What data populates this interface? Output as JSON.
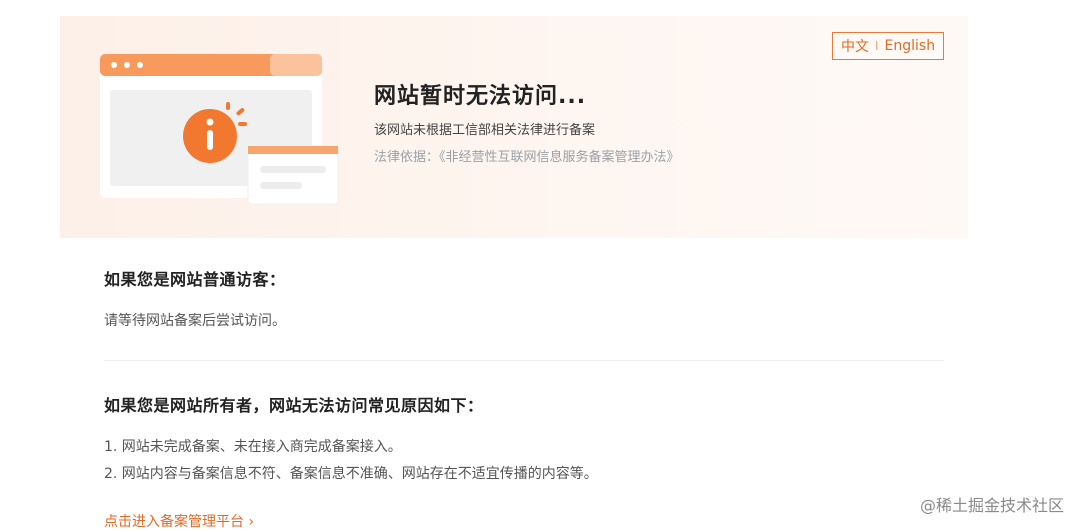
{
  "banner": {
    "title": "网站暂时无法访问...",
    "description": "该网站未根据工信部相关法律进行备案",
    "law_reference": "法律依据：《非经营性互联网信息服务备案管理办法》",
    "language_switch": {
      "chinese": "中文",
      "separator": "I",
      "english": "English"
    }
  },
  "visitor": {
    "heading": "如果您是网站普通访客：",
    "text": "请等待网站备案后尝试访问。"
  },
  "owner": {
    "heading": "如果您是网站所有者，网站无法访问常见原因如下：",
    "reasons": [
      "1. 网站未完成备案、未在接入商完成备案接入。",
      "2. 网站内容与备案信息不符、备案信息不准确、网站存在不适宜传播的内容等。"
    ]
  },
  "platform_link": "点击进入备案管理平台 ›",
  "watermark": "@稀土掘金技术社区",
  "colors": {
    "accent": "#e06a26",
    "banner_bg": "#fdf0e8"
  }
}
